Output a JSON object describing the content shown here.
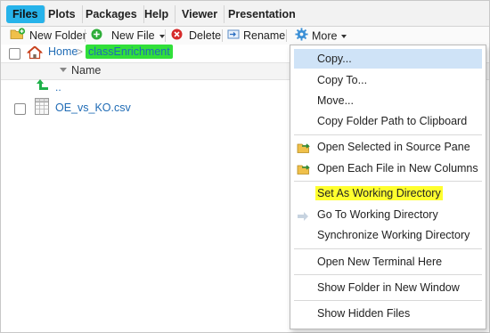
{
  "tabs": [
    {
      "label": "Files",
      "active": true
    },
    {
      "label": "Plots",
      "active": false
    },
    {
      "label": "Packages",
      "active": false
    },
    {
      "label": "Help",
      "active": false
    },
    {
      "label": "Viewer",
      "active": false
    },
    {
      "label": "Presentation",
      "active": false
    }
  ],
  "toolbar": {
    "new_folder": "New Folder",
    "new_file": "New File",
    "delete": "Delete",
    "rename": "Rename",
    "more": "More"
  },
  "breadcrumb": {
    "home": "Home",
    "separator": ">",
    "current": "classEnrichment"
  },
  "list": {
    "column_name": "Name",
    "parent_label": "..",
    "files": [
      {
        "name": "OE_vs_KO.csv",
        "icon": "spreadsheet-icon"
      }
    ]
  },
  "more_menu": {
    "items": [
      {
        "label": "Copy...",
        "icon": "",
        "state": "hovered"
      },
      {
        "label": "Copy To...",
        "icon": "",
        "state": "normal"
      },
      {
        "label": "Move...",
        "icon": "",
        "state": "normal"
      },
      {
        "label": "Copy Folder Path to Clipboard",
        "icon": "",
        "state": "normal"
      },
      {
        "label": "Open Selected in Source Pane",
        "icon": "open-folder-arrow-icon",
        "state": "normal"
      },
      {
        "label": "Open Each File in New Columns",
        "icon": "open-folder-arrow-icon",
        "state": "normal"
      },
      {
        "label": "Set As Working Directory",
        "icon": "",
        "state": "highlighted"
      },
      {
        "label": "Go To Working Directory",
        "icon": "arrow-right-icon",
        "state": "normal"
      },
      {
        "label": "Synchronize Working Directory",
        "icon": "",
        "state": "normal"
      },
      {
        "label": "Open New Terminal Here",
        "icon": "",
        "state": "normal"
      },
      {
        "label": "Show Folder in New Window",
        "icon": "",
        "state": "normal"
      },
      {
        "label": "Show Hidden Files",
        "icon": "",
        "state": "normal"
      }
    ]
  },
  "colors": {
    "active_tab": "#27b3ea",
    "breadcrumb_highlight": "#31e03a",
    "menu_highlight": "#ffff2e",
    "menu_hover": "#cfe3f7",
    "link": "#1f6bb5"
  }
}
